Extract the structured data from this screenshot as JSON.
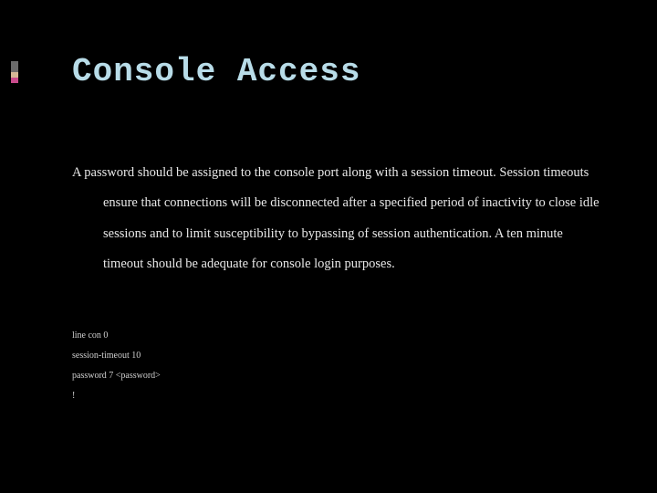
{
  "title": "Console Access",
  "body": "A password should be assigned to the console port along with a session timeout.  Session timeouts ensure that connections will be disconnected after a specified period of inactivity to close idle sessions and to limit susceptibility to bypassing of session authentication.  A ten minute timeout should be adequate for console login purposes.",
  "code": {
    "line1": "line con 0",
    "line2": "session-timeout 10",
    "line3": "password 7 <password>",
    "line4": "!"
  },
  "accent_colors": {
    "top": "#6b6b6b",
    "middle": "#d4b896",
    "bottom": "#c94b8c"
  }
}
